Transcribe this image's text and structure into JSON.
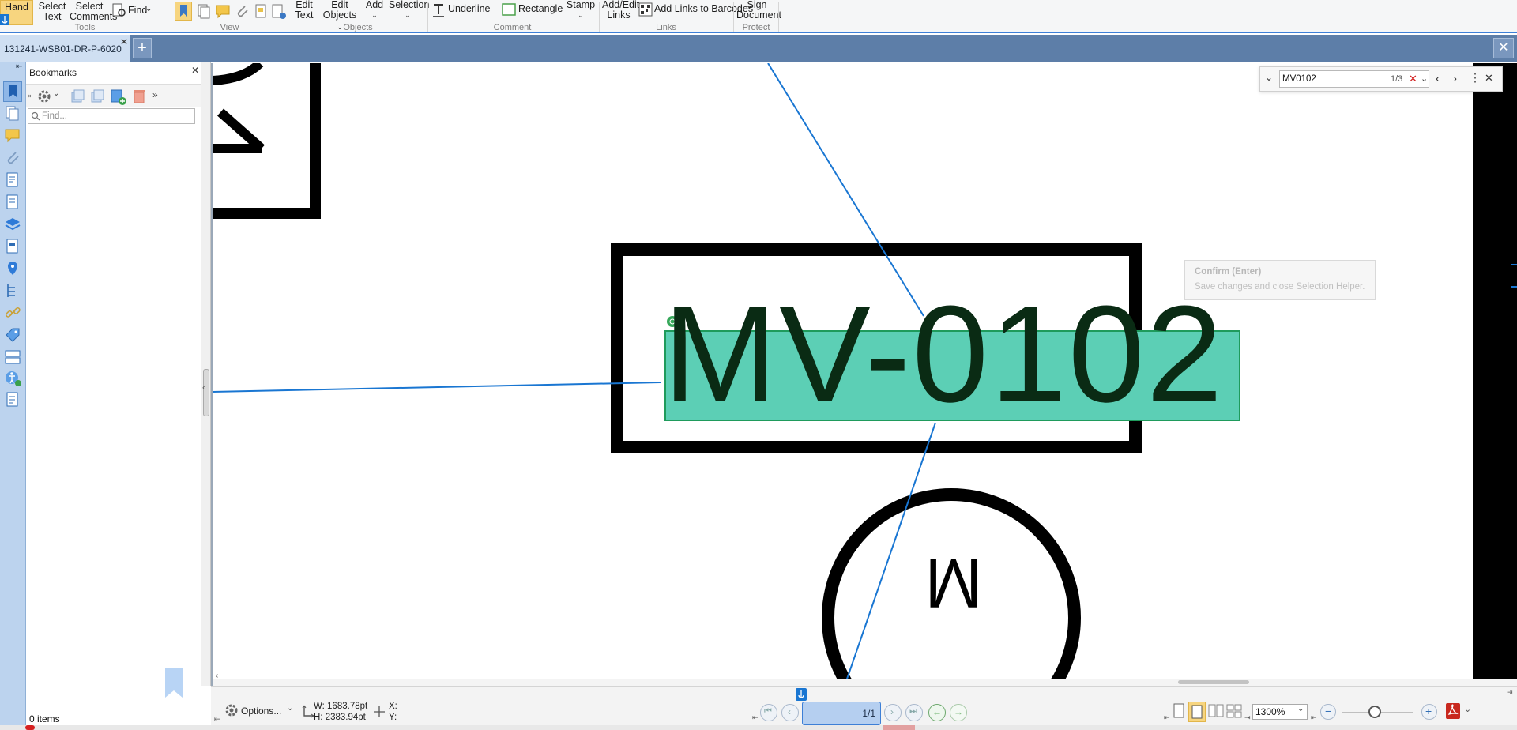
{
  "ribbon": {
    "hand": "Hand",
    "select_text_1": "Select",
    "select_text_2": "Text",
    "select_comments_1": "Select",
    "select_comments_2": "Comments",
    "find": "Find",
    "edit_text_1": "Edit",
    "edit_text_2": "Text",
    "edit_objects_1": "Edit",
    "edit_objects_2": "Objects",
    "add": "Add",
    "selection": "Selection",
    "underline": "Underline",
    "rectangle": "Rectangle",
    "stamp": "Stamp",
    "add_edit_links_1": "Add/Edit",
    "add_edit_links_2": "Links",
    "add_links_barcodes": "Add Links to Barcodes",
    "sign_document_1": "Sign",
    "sign_document_2": "Document",
    "groups": {
      "tools": "Tools",
      "view": "View",
      "objects": "Objects",
      "comment": "Comment",
      "links": "Links",
      "protect": "Protect"
    }
  },
  "tab": {
    "title": "131241-WSB01-DR-P-6020"
  },
  "bookmarks": {
    "title": "Bookmarks",
    "find_placeholder": "Find...",
    "items_count": "0 items"
  },
  "search": {
    "query": "MV0102",
    "count": "1/3"
  },
  "tooltip": {
    "title": "Confirm (Enter)",
    "text": "Save changes and close Selection Helper."
  },
  "drawing": {
    "tag_label": "MV-0102",
    "motor_label": "M"
  },
  "status": {
    "options": "Options...",
    "width": "W: 1683.78pt",
    "height": "H: 2383.94pt",
    "x": "X:",
    "y": "Y:",
    "page": "1/1",
    "zoom": "1300%"
  },
  "colors": {
    "accent_blue": "#1976d2",
    "highlight_teal": "#5ccfb5",
    "tab_bar": "#5d7ea8",
    "ribbon_active": "#f7d57f"
  }
}
